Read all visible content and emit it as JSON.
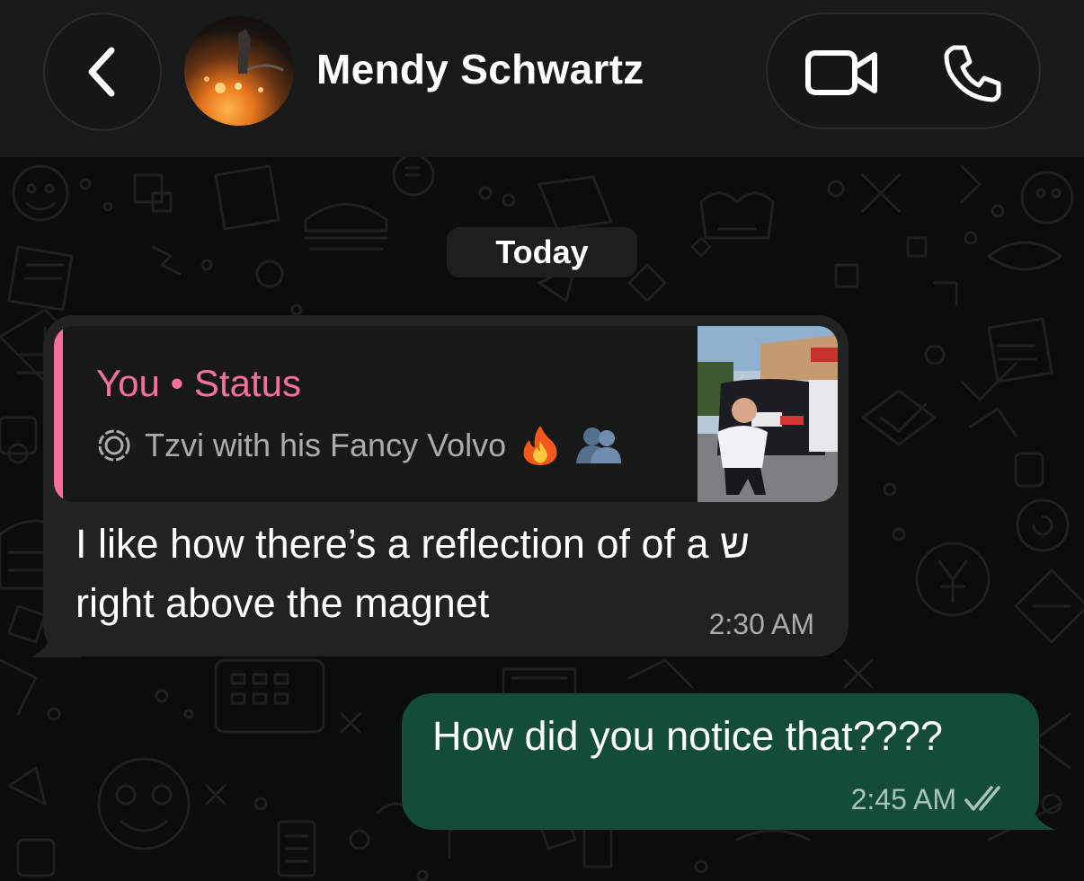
{
  "header": {
    "contact_name": "Mendy Schwartz",
    "back_icon": "chevron-left-icon",
    "video_icon": "video-camera-icon",
    "phone_icon": "phone-icon"
  },
  "chat": {
    "date_label": "Today",
    "messages": [
      {
        "direction": "incoming",
        "reply_to": {
          "title": "You • Status",
          "caption": "Tzvi with his Fancy Volvo",
          "caption_icon": "status-ring-icon",
          "emojis": [
            "fire-emoji",
            "people-hugging-emoji"
          ]
        },
        "text": "I like how there’s a reflection of of a ש right above the magnet",
        "time": "2:30 AM"
      },
      {
        "direction": "outgoing",
        "text": "How did you notice that????",
        "time": "2:45 AM",
        "receipt_icon": "double-check-icon"
      }
    ]
  },
  "colors": {
    "header_bg": "#171a19",
    "incoming_bubble": "#212322",
    "outgoing_bubble": "#134d37",
    "status_accent": "#f5709e"
  }
}
